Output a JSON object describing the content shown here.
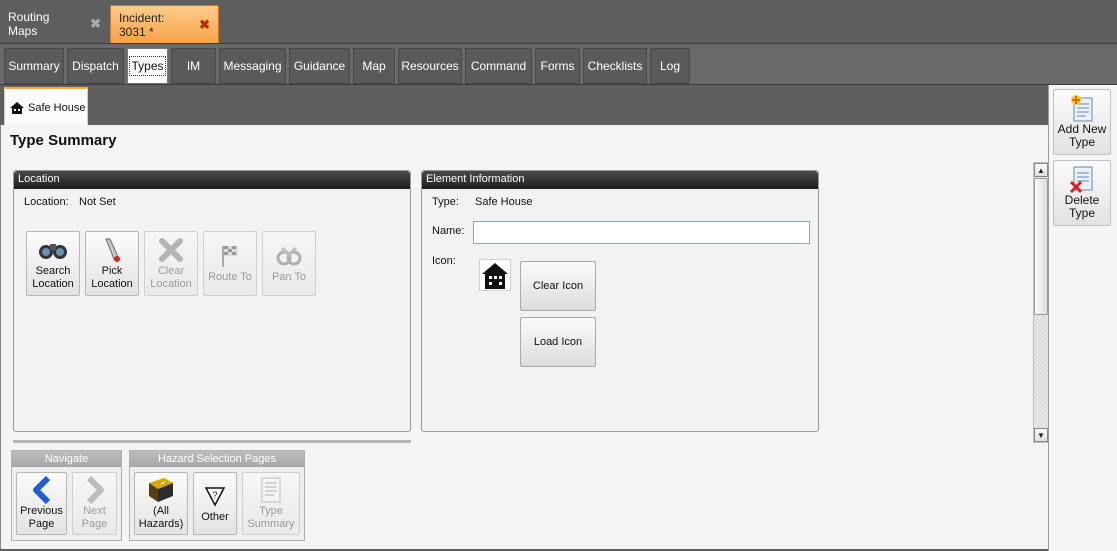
{
  "doc_tabs": [
    {
      "label": "Routing Maps",
      "close": "✖"
    },
    {
      "label": "Incident: 3031 *",
      "close": "✖"
    }
  ],
  "module_tabs": [
    "Summary",
    "Dispatch",
    "Types",
    "IM",
    "Messaging",
    "Guidance",
    "Map",
    "Resources",
    "Command",
    "Forms",
    "Checklists",
    "Log"
  ],
  "active_module_tab": "Types",
  "sub_tab": {
    "label": "Safe House",
    "icon": "house-icon"
  },
  "page_title": "Type Summary",
  "location_panel": {
    "title": "Location",
    "location_label": "Location:",
    "location_value": "Not Set",
    "buttons": [
      {
        "line1": "Search",
        "line2": "Location",
        "icon": "binoculars-icon",
        "enabled": true
      },
      {
        "line1": "Pick",
        "line2": "Location",
        "icon": "pick-pen-icon",
        "enabled": true
      },
      {
        "line1": "Clear",
        "line2": "Location",
        "icon": "clear-x-icon",
        "enabled": false
      },
      {
        "line1": "Route To",
        "line2": "",
        "icon": "checkered-flag-icon",
        "enabled": false
      },
      {
        "line1": "Pan To",
        "line2": "",
        "icon": "pan-icon",
        "enabled": false
      }
    ]
  },
  "element_panel": {
    "title": "Element Information",
    "type_label": "Type:",
    "type_value": "Safe House",
    "name_label": "Name:",
    "name_value": "",
    "icon_label": "Icon:",
    "clear_icon_label": "Clear Icon",
    "load_icon_label": "Load Icon"
  },
  "navigate": {
    "title": "Navigate",
    "previous": {
      "line1": "Previous",
      "line2": "Page",
      "enabled": true
    },
    "next": {
      "line1": "Next",
      "line2": "Page",
      "enabled": false
    }
  },
  "hazard": {
    "title": "Hazard Selection Pages",
    "all": {
      "line1": "(All",
      "line2": "Hazards)"
    },
    "other": {
      "line1": "Other"
    },
    "type_summary": {
      "line1": "Type",
      "line2": "Summary",
      "enabled": false
    }
  },
  "side_panel": {
    "add": {
      "line1": "Add New",
      "line2": "Type"
    },
    "delete": {
      "line1": "Delete",
      "line2": "Type"
    }
  },
  "colors": {
    "active_doc_tab": "#f7a247",
    "panel_header": "#1e1e1e",
    "accent_blue": "#1f5fd0"
  }
}
